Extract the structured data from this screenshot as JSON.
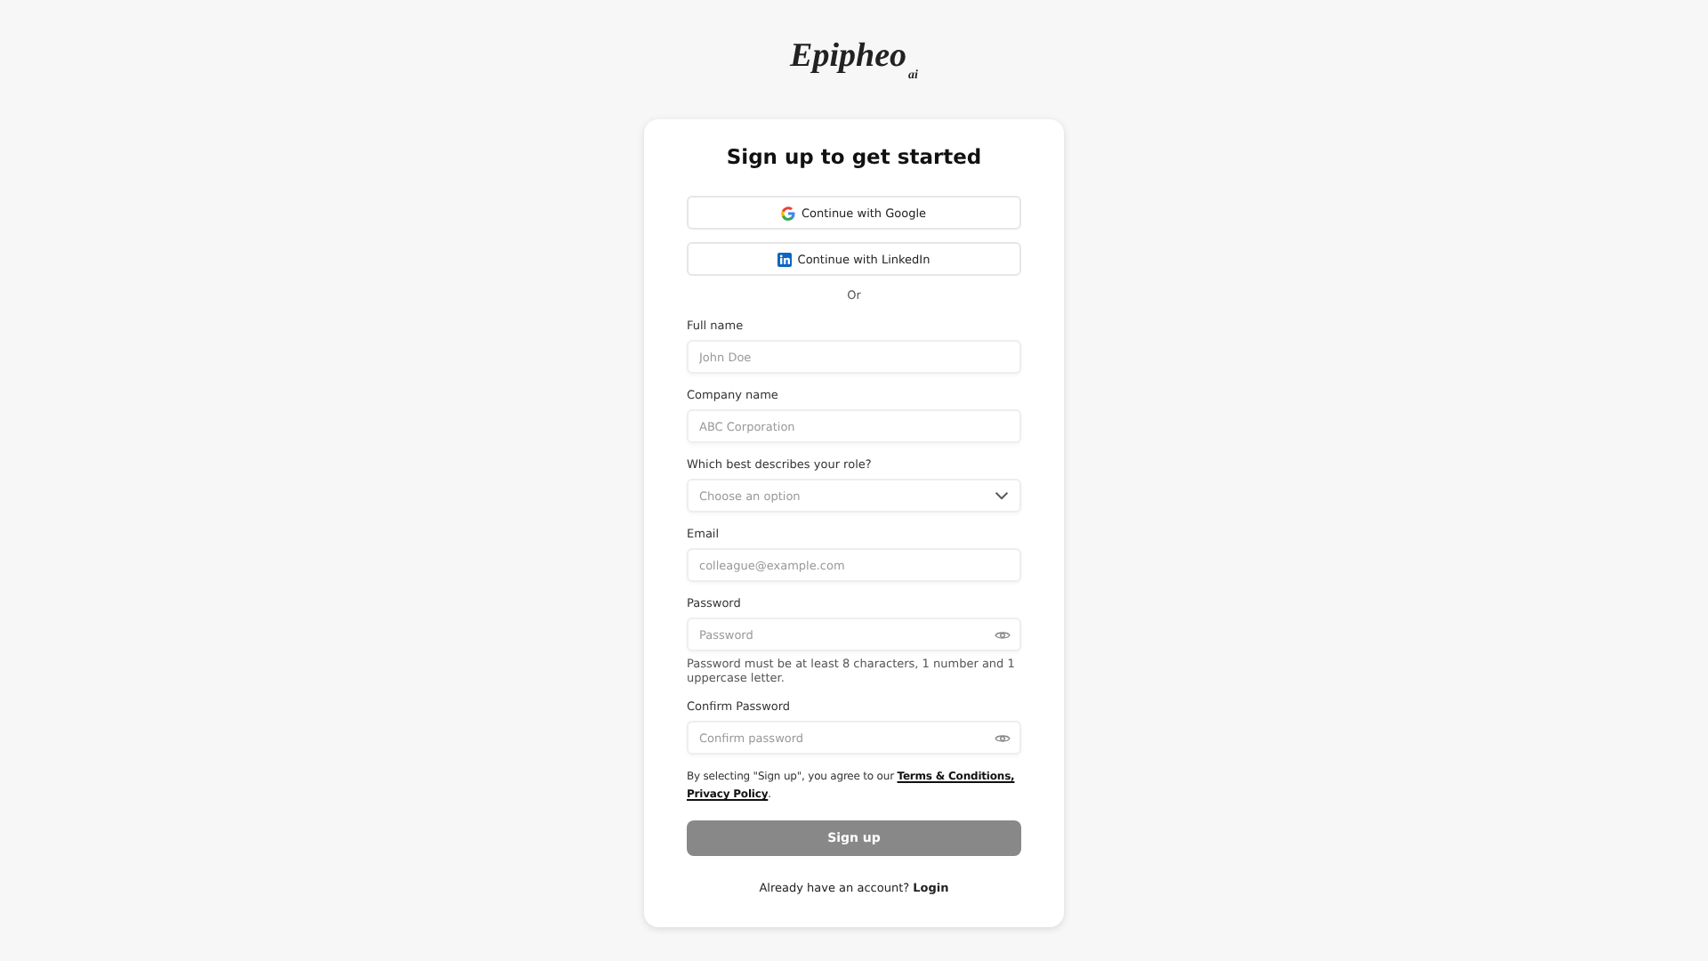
{
  "logo": {
    "name": "Epipheo",
    "suffix": "ai"
  },
  "title": "Sign up to get started",
  "social_buttons": [
    {
      "kind": "google",
      "label": "Continue with Google"
    },
    {
      "kind": "linkedin",
      "label": "Continue with LinkedIn"
    }
  ],
  "divider": "Or",
  "fields": [
    {
      "kind": "text",
      "label": "Full name",
      "placeholder": "John Doe"
    },
    {
      "kind": "text",
      "label": "Company name",
      "placeholder": "ABC Corporation"
    },
    {
      "kind": "select",
      "label": "Which best describes your role?",
      "placeholder": "Choose an option"
    },
    {
      "kind": "text",
      "label": "Email",
      "placeholder": "colleague@example.com"
    },
    {
      "kind": "password",
      "label": "Password",
      "placeholder": "Password",
      "hint": "Password must be at least 8 characters, 1 number and 1 uppercase letter."
    },
    {
      "kind": "password",
      "label": "Confirm Password",
      "placeholder": "Confirm password"
    }
  ],
  "terms": {
    "text": "By selecting \"Sign up\", you agree to our",
    "links": [
      "Terms & Conditions,",
      "Privacy Policy"
    ],
    "end": "."
  },
  "submit": {
    "label": "Sign up",
    "disabled": true
  },
  "footer": {
    "text": "Already have an account?",
    "link": "Login"
  }
}
